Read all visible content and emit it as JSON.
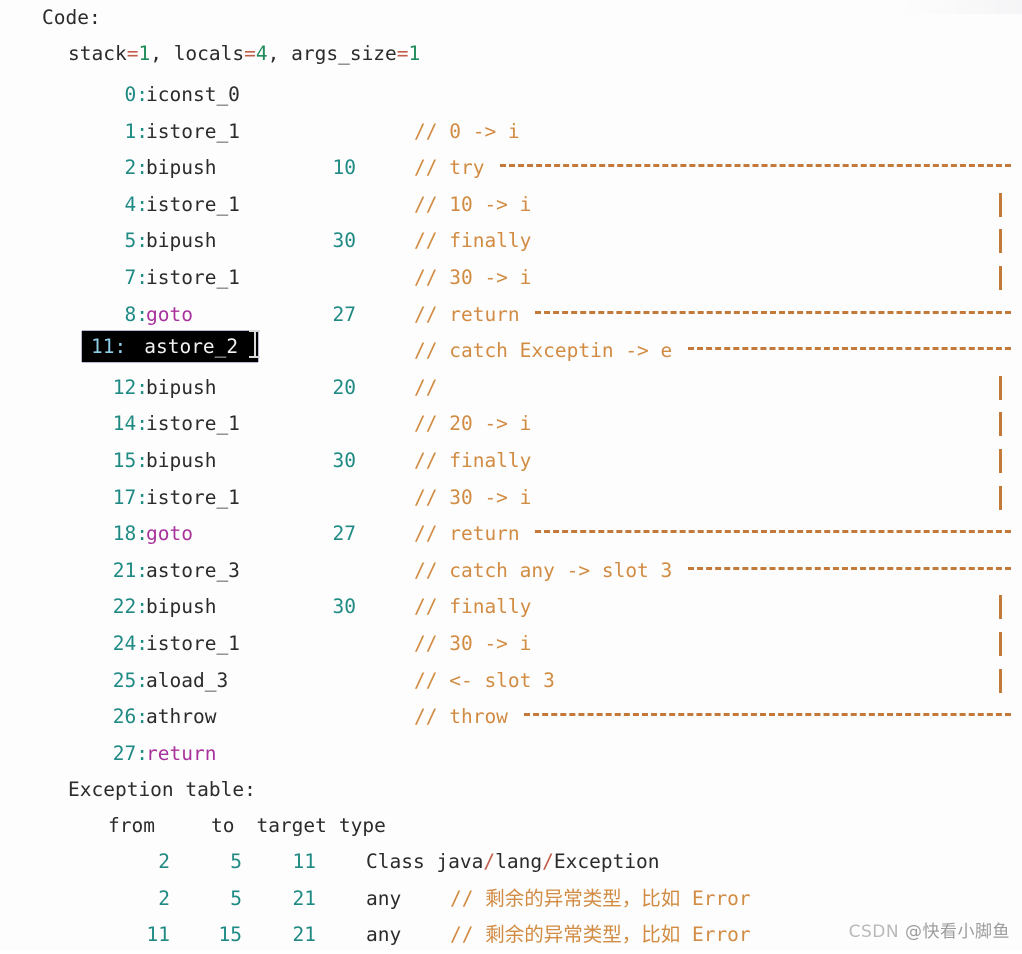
{
  "document": {
    "title": "Code:",
    "frame_line": "stack=1, locals=4, args_size=1",
    "frame_tokens": {
      "stack_label": "stack",
      "stack_value": "1",
      "sep1": ", ",
      "locals_label": "locals",
      "locals_value": "4",
      "sep2": ", ",
      "args_label": "args_size",
      "args_value": "1",
      "eq": "="
    }
  },
  "colors": {
    "background": "#fdfdfd",
    "plain_text": "#2b2b2b",
    "number": "#1f8a84",
    "keyword": "#a8329c",
    "comment": "#d18b42",
    "operator": "#c25d4a",
    "literal": "#1f8a5a",
    "selection_bg": "#000000",
    "selection_text": "#f2f2f2",
    "selection_number": "#8fd0e8",
    "watermark": "#b9b9b9"
  },
  "instructions": [
    {
      "pc": "0:",
      "mnemonic": "iconst_0",
      "mnemonic_kind": "plain",
      "operand": "",
      "comment": "",
      "rule": "none",
      "selected": false
    },
    {
      "pc": "1:",
      "mnemonic": "istore_1",
      "mnemonic_kind": "plain",
      "operand": "",
      "comment": "// 0 -> i",
      "rule": "none",
      "selected": false
    },
    {
      "pc": "2:",
      "mnemonic": "bipush",
      "mnemonic_kind": "plain",
      "operand": "10",
      "comment": "// try ",
      "rule": "dash",
      "selected": false
    },
    {
      "pc": "4:",
      "mnemonic": "istore_1",
      "mnemonic_kind": "plain",
      "operand": "",
      "comment": "// 10 -> i",
      "rule": "pipe",
      "selected": false
    },
    {
      "pc": "5:",
      "mnemonic": "bipush",
      "mnemonic_kind": "plain",
      "operand": "30",
      "comment": "// finally",
      "rule": "pipe",
      "selected": false
    },
    {
      "pc": "7:",
      "mnemonic": "istore_1",
      "mnemonic_kind": "plain",
      "operand": "",
      "comment": "// 30 -> i",
      "rule": "pipe",
      "selected": false
    },
    {
      "pc": "8:",
      "mnemonic": "goto",
      "mnemonic_kind": "keyword",
      "operand": "27",
      "comment": "// return ",
      "rule": "dash",
      "selected": false
    },
    {
      "pc": "11:",
      "mnemonic": "astore_2",
      "mnemonic_kind": "plain",
      "operand": "",
      "comment": "// catch Exceptin -> e ",
      "rule": "dash",
      "selected": true
    },
    {
      "pc": "12:",
      "mnemonic": "bipush",
      "mnemonic_kind": "plain",
      "operand": "20",
      "comment": "//",
      "rule": "pipe",
      "selected": false
    },
    {
      "pc": "14:",
      "mnemonic": "istore_1",
      "mnemonic_kind": "plain",
      "operand": "",
      "comment": "// 20 -> i",
      "rule": "pipe",
      "selected": false
    },
    {
      "pc": "15:",
      "mnemonic": "bipush",
      "mnemonic_kind": "plain",
      "operand": "30",
      "comment": "// finally",
      "rule": "pipe",
      "selected": false
    },
    {
      "pc": "17:",
      "mnemonic": "istore_1",
      "mnemonic_kind": "plain",
      "operand": "",
      "comment": "// 30 -> i",
      "rule": "pipe",
      "selected": false
    },
    {
      "pc": "18:",
      "mnemonic": "goto",
      "mnemonic_kind": "keyword",
      "operand": "27",
      "comment": "// return ",
      "rule": "dash",
      "selected": false
    },
    {
      "pc": "21:",
      "mnemonic": "astore_3",
      "mnemonic_kind": "plain",
      "operand": "",
      "comment": "// catch any -> slot 3 ",
      "rule": "dash",
      "selected": false
    },
    {
      "pc": "22:",
      "mnemonic": "bipush",
      "mnemonic_kind": "plain",
      "operand": "30",
      "comment": "// finally",
      "rule": "pipe",
      "selected": false
    },
    {
      "pc": "24:",
      "mnemonic": "istore_1",
      "mnemonic_kind": "plain",
      "operand": "",
      "comment": "// 30 -> i",
      "rule": "pipe",
      "selected": false
    },
    {
      "pc": "25:",
      "mnemonic": "aload_3",
      "mnemonic_kind": "plain",
      "operand": "",
      "comment": "// <- slot 3",
      "rule": "pipe",
      "selected": false
    },
    {
      "pc": "26:",
      "mnemonic": "athrow",
      "mnemonic_kind": "plain",
      "operand": "",
      "comment": "// throw ",
      "rule": "dash",
      "selected": false
    },
    {
      "pc": "27:",
      "mnemonic": "return",
      "mnemonic_kind": "keyword",
      "operand": "",
      "comment": "",
      "rule": "none",
      "selected": false
    }
  ],
  "exception_table": {
    "title": "Exception table:",
    "headers": [
      "from",
      "to",
      "target",
      "type"
    ],
    "rows": [
      {
        "from": "2",
        "to": "5",
        "target": "11",
        "type": "Class java/lang/Exception",
        "type_kind": "class",
        "comment": ""
      },
      {
        "from": "2",
        "to": "5",
        "target": "21",
        "type": "any",
        "type_kind": "plain",
        "comment": "// 剩余的异常类型，比如 Error"
      },
      {
        "from": "11",
        "to": "15",
        "target": "21",
        "type": "any",
        "type_kind": "plain",
        "comment": "// 剩余的异常类型，比如 Error"
      }
    ]
  },
  "watermark": {
    "brand": "CSDN",
    "user": "@快看小脚鱼"
  }
}
